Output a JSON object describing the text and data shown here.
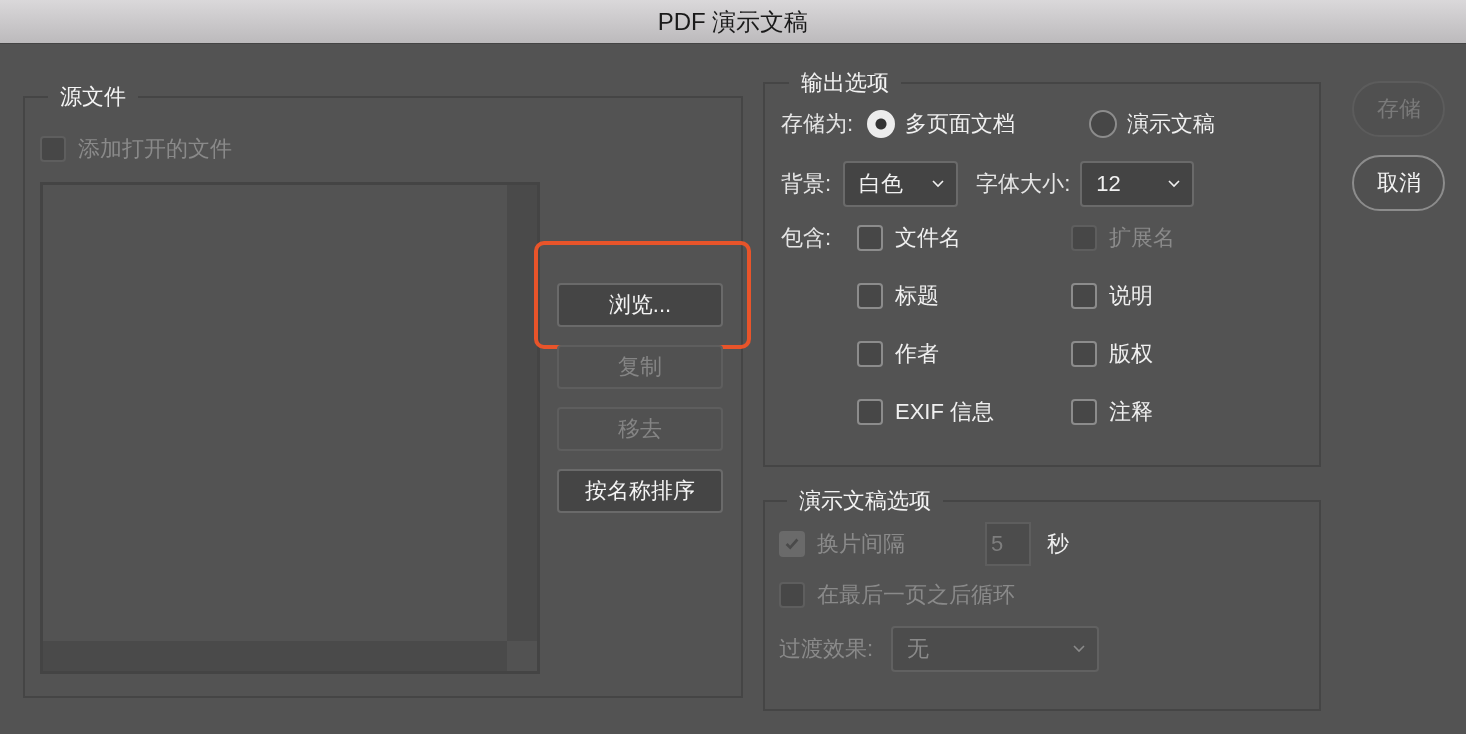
{
  "window": {
    "title": "PDF 演示文稿"
  },
  "source_files": {
    "legend": "源文件",
    "add_open_files": {
      "label": "添加打开的文件",
      "checked": false,
      "disabled": true
    },
    "buttons": [
      {
        "label": "浏览...",
        "disabled": false,
        "highlighted": true
      },
      {
        "label": "复制",
        "disabled": true,
        "highlighted": false
      },
      {
        "label": "移去",
        "disabled": true,
        "highlighted": false
      },
      {
        "label": "按名称排序",
        "disabled": false,
        "highlighted": false
      }
    ]
  },
  "output_options": {
    "legend": "输出选项",
    "save_as": {
      "label": "存储为:",
      "options": [
        {
          "label": "多页面文档",
          "selected": true
        },
        {
          "label": "演示文稿",
          "selected": false
        }
      ]
    },
    "background": {
      "label": "背景:",
      "value": "白色"
    },
    "font_size": {
      "label": "字体大小:",
      "value": "12"
    },
    "include": {
      "label": "包含:",
      "items": [
        {
          "label": "文件名",
          "checked": false,
          "disabled": false
        },
        {
          "label": "扩展名",
          "checked": false,
          "disabled": true
        },
        {
          "label": "标题",
          "checked": false,
          "disabled": false
        },
        {
          "label": "说明",
          "checked": false,
          "disabled": false
        },
        {
          "label": "作者",
          "checked": false,
          "disabled": false
        },
        {
          "label": "版权",
          "checked": false,
          "disabled": false
        },
        {
          "label": "EXIF 信息",
          "checked": false,
          "disabled": false
        },
        {
          "label": "注释",
          "checked": false,
          "disabled": false
        }
      ]
    }
  },
  "presentation_options": {
    "legend": "演示文稿选项",
    "advance": {
      "label": "换片间隔",
      "checked": true,
      "disabled": true,
      "value": "5",
      "unit": "秒"
    },
    "loop": {
      "label": "在最后一页之后循环",
      "checked": false,
      "disabled": true
    },
    "transition": {
      "label": "过渡效果:",
      "value": "无",
      "disabled": true
    }
  },
  "actions": [
    {
      "label": "存储",
      "disabled": true
    },
    {
      "label": "取消",
      "disabled": false
    }
  ]
}
